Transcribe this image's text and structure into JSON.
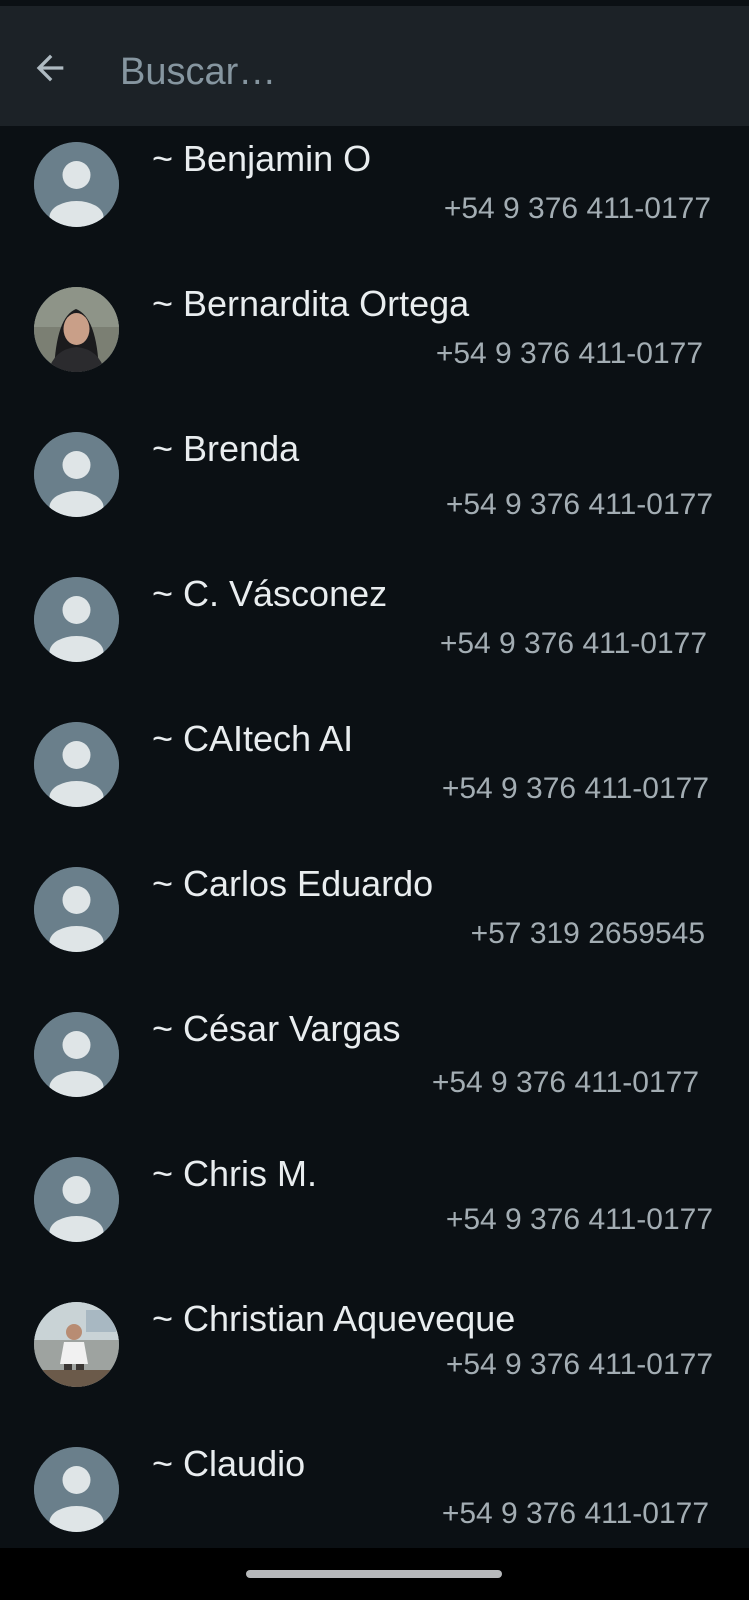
{
  "search": {
    "placeholder": "Buscar…"
  },
  "contacts": [
    {
      "name": "~ Benjamin O",
      "phone": "+54 9 376 411-0177",
      "avatar": "default"
    },
    {
      "name": "~ Bernardita Ortega",
      "phone": "+54 9 376 411-0177",
      "avatar": "photo"
    },
    {
      "name": "~ Brenda",
      "phone": "+54 9 376 411-0177",
      "avatar": "default"
    },
    {
      "name": "~ C. Vásconez",
      "phone": "+54 9 376 411-0177",
      "avatar": "default"
    },
    {
      "name": "~ CAItech AI",
      "phone": "+54 9 376 411-0177",
      "avatar": "default"
    },
    {
      "name": "~ Carlos Eduardo",
      "phone": "+57 319 2659545",
      "avatar": "default"
    },
    {
      "name": "~ César Vargas",
      "phone": "+54 9 376 411-0177",
      "avatar": "default"
    },
    {
      "name": "~ Chris M.",
      "phone": "+54 9 376 411-0177",
      "avatar": "default"
    },
    {
      "name": "~ Christian Aqueveque",
      "phone": "+54 9 376 411-0177",
      "avatar": "photo"
    },
    {
      "name": "~ Claudio",
      "phone": "+54 9 376 411-0177",
      "avatar": "default"
    }
  ],
  "colors": {
    "background": "#0b1014",
    "search_bar": "#1c2227",
    "name_text": "#e9edef",
    "phone_text": "#a3adb3",
    "avatar_default": "#6a7f8b"
  }
}
